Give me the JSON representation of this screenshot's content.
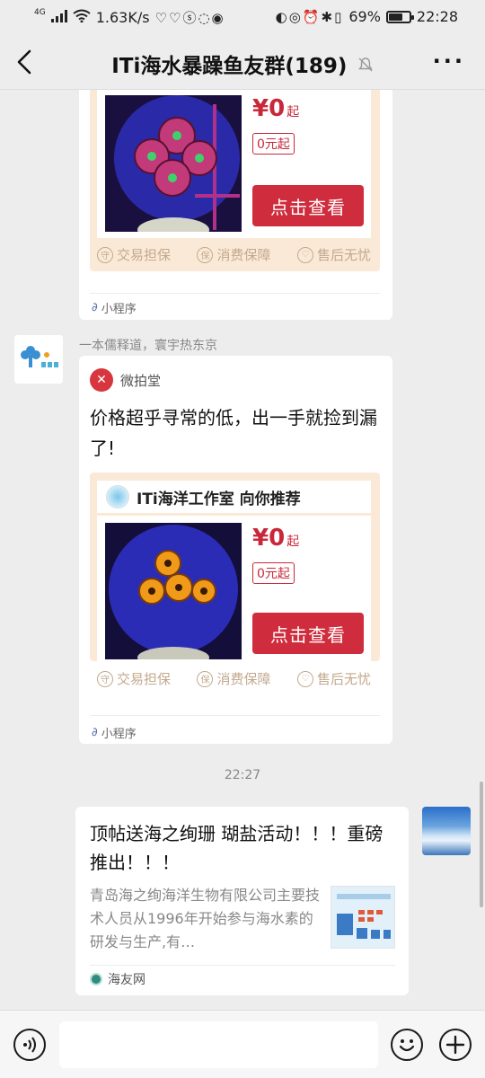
{
  "status_bar": {
    "network": "4G",
    "speed": "1.63K/s",
    "battery": "69%",
    "battery_level": 0.69,
    "time": "22:28"
  },
  "header": {
    "title": "ITi海水暴躁鱼友群(189)",
    "more_label": "···"
  },
  "messages": [
    {
      "type": "mini_program_card",
      "card": {
        "price": "¥0",
        "price_suffix": "起",
        "tag": "0元起",
        "button": "点击查看",
        "guarantees": [
          "交易担保",
          "消费保障",
          "售后无忧"
        ]
      },
      "footer": "小程序"
    },
    {
      "type": "mini_program_card",
      "sender": "一本儒释道，寰宇热东京",
      "source": "微拍堂",
      "text": "价格超乎寻常的低，出一手就捡到漏了!",
      "card": {
        "header": "ITi海洋工作室 向你推荐",
        "price": "¥0",
        "price_suffix": "起",
        "tag": "0元起",
        "button": "点击查看",
        "guarantees": [
          "交易担保",
          "消费保障",
          "售后无忧"
        ]
      },
      "footer": "小程序"
    },
    {
      "type": "timestamp",
      "time": "22:27"
    },
    {
      "type": "link_card",
      "title": "顶帖送海之绚珊 瑚盐活动！！！重磅推出！！！",
      "description": "青岛海之绚海洋生物有限公司主要技术人员从1996年开始参与海水素的研发与生产,有…",
      "source": "海友网"
    }
  ],
  "colors": {
    "price_red": "#c8283a",
    "button_red": "#cf2d3d",
    "card_bg": "#fbe9d8",
    "chat_bg": "#ededed"
  }
}
